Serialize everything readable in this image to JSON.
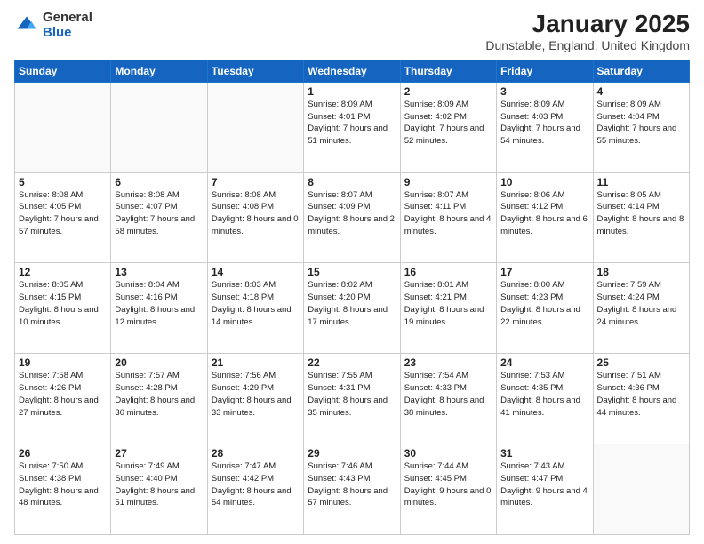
{
  "logo": {
    "general": "General",
    "blue": "Blue"
  },
  "title": "January 2025",
  "subtitle": "Dunstable, England, United Kingdom",
  "days_of_week": [
    "Sunday",
    "Monday",
    "Tuesday",
    "Wednesday",
    "Thursday",
    "Friday",
    "Saturday"
  ],
  "weeks": [
    [
      {
        "num": "",
        "info": ""
      },
      {
        "num": "",
        "info": ""
      },
      {
        "num": "",
        "info": ""
      },
      {
        "num": "1",
        "info": "Sunrise: 8:09 AM\nSunset: 4:01 PM\nDaylight: 7 hours\nand 51 minutes."
      },
      {
        "num": "2",
        "info": "Sunrise: 8:09 AM\nSunset: 4:02 PM\nDaylight: 7 hours\nand 52 minutes."
      },
      {
        "num": "3",
        "info": "Sunrise: 8:09 AM\nSunset: 4:03 PM\nDaylight: 7 hours\nand 54 minutes."
      },
      {
        "num": "4",
        "info": "Sunrise: 8:09 AM\nSunset: 4:04 PM\nDaylight: 7 hours\nand 55 minutes."
      }
    ],
    [
      {
        "num": "5",
        "info": "Sunrise: 8:08 AM\nSunset: 4:05 PM\nDaylight: 7 hours\nand 57 minutes."
      },
      {
        "num": "6",
        "info": "Sunrise: 8:08 AM\nSunset: 4:07 PM\nDaylight: 7 hours\nand 58 minutes."
      },
      {
        "num": "7",
        "info": "Sunrise: 8:08 AM\nSunset: 4:08 PM\nDaylight: 8 hours\nand 0 minutes."
      },
      {
        "num": "8",
        "info": "Sunrise: 8:07 AM\nSunset: 4:09 PM\nDaylight: 8 hours\nand 2 minutes."
      },
      {
        "num": "9",
        "info": "Sunrise: 8:07 AM\nSunset: 4:11 PM\nDaylight: 8 hours\nand 4 minutes."
      },
      {
        "num": "10",
        "info": "Sunrise: 8:06 AM\nSunset: 4:12 PM\nDaylight: 8 hours\nand 6 minutes."
      },
      {
        "num": "11",
        "info": "Sunrise: 8:05 AM\nSunset: 4:14 PM\nDaylight: 8 hours\nand 8 minutes."
      }
    ],
    [
      {
        "num": "12",
        "info": "Sunrise: 8:05 AM\nSunset: 4:15 PM\nDaylight: 8 hours\nand 10 minutes."
      },
      {
        "num": "13",
        "info": "Sunrise: 8:04 AM\nSunset: 4:16 PM\nDaylight: 8 hours\nand 12 minutes."
      },
      {
        "num": "14",
        "info": "Sunrise: 8:03 AM\nSunset: 4:18 PM\nDaylight: 8 hours\nand 14 minutes."
      },
      {
        "num": "15",
        "info": "Sunrise: 8:02 AM\nSunset: 4:20 PM\nDaylight: 8 hours\nand 17 minutes."
      },
      {
        "num": "16",
        "info": "Sunrise: 8:01 AM\nSunset: 4:21 PM\nDaylight: 8 hours\nand 19 minutes."
      },
      {
        "num": "17",
        "info": "Sunrise: 8:00 AM\nSunset: 4:23 PM\nDaylight: 8 hours\nand 22 minutes."
      },
      {
        "num": "18",
        "info": "Sunrise: 7:59 AM\nSunset: 4:24 PM\nDaylight: 8 hours\nand 24 minutes."
      }
    ],
    [
      {
        "num": "19",
        "info": "Sunrise: 7:58 AM\nSunset: 4:26 PM\nDaylight: 8 hours\nand 27 minutes."
      },
      {
        "num": "20",
        "info": "Sunrise: 7:57 AM\nSunset: 4:28 PM\nDaylight: 8 hours\nand 30 minutes."
      },
      {
        "num": "21",
        "info": "Sunrise: 7:56 AM\nSunset: 4:29 PM\nDaylight: 8 hours\nand 33 minutes."
      },
      {
        "num": "22",
        "info": "Sunrise: 7:55 AM\nSunset: 4:31 PM\nDaylight: 8 hours\nand 35 minutes."
      },
      {
        "num": "23",
        "info": "Sunrise: 7:54 AM\nSunset: 4:33 PM\nDaylight: 8 hours\nand 38 minutes."
      },
      {
        "num": "24",
        "info": "Sunrise: 7:53 AM\nSunset: 4:35 PM\nDaylight: 8 hours\nand 41 minutes."
      },
      {
        "num": "25",
        "info": "Sunrise: 7:51 AM\nSunset: 4:36 PM\nDaylight: 8 hours\nand 44 minutes."
      }
    ],
    [
      {
        "num": "26",
        "info": "Sunrise: 7:50 AM\nSunset: 4:38 PM\nDaylight: 8 hours\nand 48 minutes."
      },
      {
        "num": "27",
        "info": "Sunrise: 7:49 AM\nSunset: 4:40 PM\nDaylight: 8 hours\nand 51 minutes."
      },
      {
        "num": "28",
        "info": "Sunrise: 7:47 AM\nSunset: 4:42 PM\nDaylight: 8 hours\nand 54 minutes."
      },
      {
        "num": "29",
        "info": "Sunrise: 7:46 AM\nSunset: 4:43 PM\nDaylight: 8 hours\nand 57 minutes."
      },
      {
        "num": "30",
        "info": "Sunrise: 7:44 AM\nSunset: 4:45 PM\nDaylight: 9 hours\nand 0 minutes."
      },
      {
        "num": "31",
        "info": "Sunrise: 7:43 AM\nSunset: 4:47 PM\nDaylight: 9 hours\nand 4 minutes."
      },
      {
        "num": "",
        "info": ""
      }
    ]
  ]
}
